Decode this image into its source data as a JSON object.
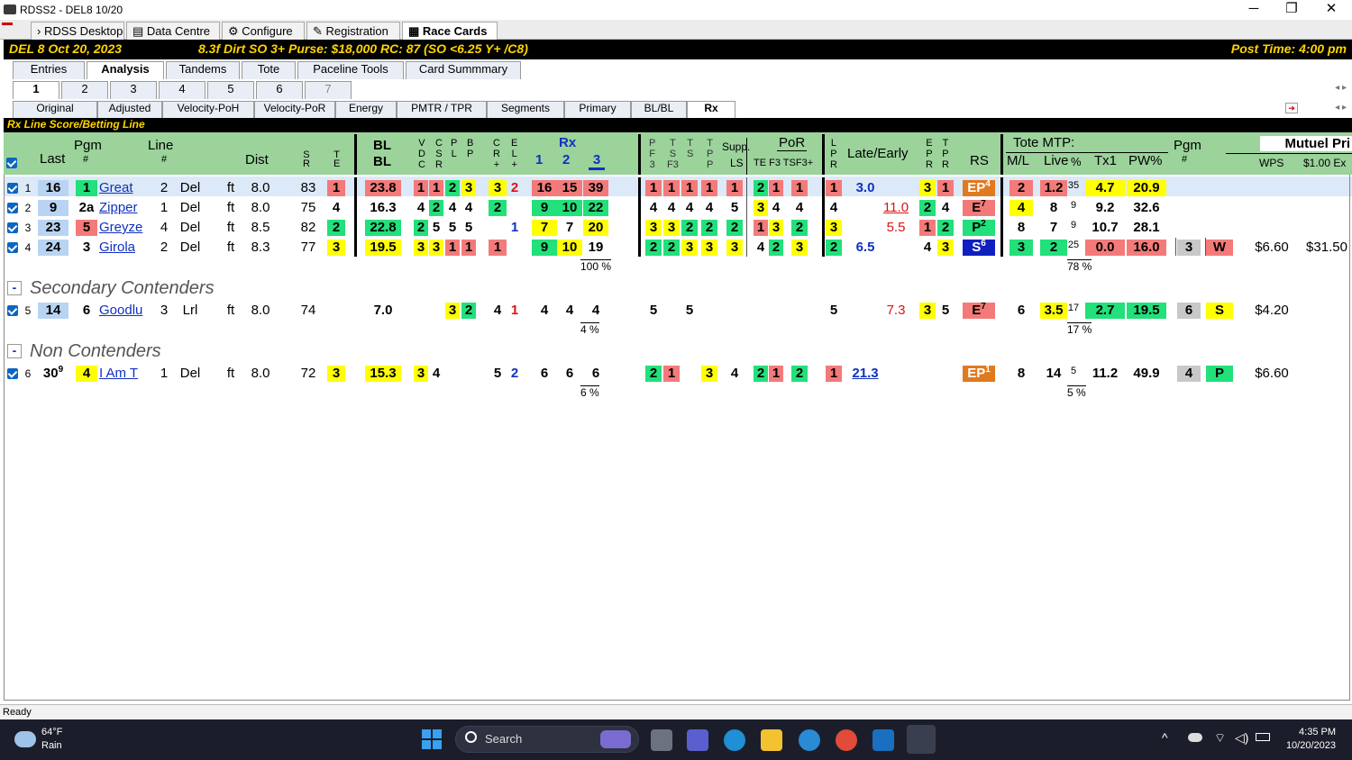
{
  "window": {
    "title": "RDSS2 - DEL8  10/20",
    "minimize": "─",
    "maximize": "❐",
    "close": "✕"
  },
  "top_tabs": [
    "RDSS Desktop",
    "Data Centre",
    "Configure",
    "Registration",
    "Race Cards"
  ],
  "race_bar": {
    "track": "DEL  8  Oct 20, 2023",
    "conditions": "8.3f  Dirt   SO  3+   Purse: $18,000   RC: 87  (SO <6.25 Y+ /C8)",
    "post_time": "Post Time: 4:00 pm"
  },
  "view_tabs": [
    "Entries",
    "Analysis",
    "Tandems",
    "Tote",
    "Paceline Tools",
    "Card Summmary"
  ],
  "race_tabs": [
    "1",
    "2",
    "3",
    "4",
    "5",
    "6",
    "7"
  ],
  "analysis_tabs": [
    "Original",
    "Adjusted",
    "Velocity-PoH",
    "Velocity-PoR",
    "Energy",
    "PMTR / TPR",
    "Segments",
    "Primary",
    "BL/BL",
    "Rx"
  ],
  "rx_title": "Rx Line Score/Betting Line",
  "header": {
    "last": "Last",
    "pgm": "Pgm",
    "pgm_hash": "#",
    "line": "Line",
    "line_hash": "#",
    "dist": "Dist",
    "sr_s": "S",
    "sr_r": "R",
    "te_t": "T",
    "te_e": "E",
    "bl1": "BL",
    "bl2": "BL",
    "vdc": [
      "V",
      "D",
      "C"
    ],
    "csr": [
      "C",
      "S",
      "R"
    ],
    "pl": [
      "P",
      "L"
    ],
    "bp": [
      "B",
      "P"
    ],
    "crp": [
      "C",
      "R",
      "+"
    ],
    "elp": [
      "E",
      "L",
      "+"
    ],
    "rx": "Rx",
    "rx1": "1",
    "rx2": "2",
    "rx3": "3",
    "pf3": [
      "P",
      "F",
      "3"
    ],
    "tsf3": [
      "T",
      "S",
      "F3"
    ],
    "ts": [
      "T",
      "S"
    ],
    "tpp": [
      "T",
      "P",
      "P"
    ],
    "supp": "Supp.",
    "ls": "LS",
    "por": "PoR",
    "por_sub": "TE F3  TSF3+",
    "lpr": [
      "L",
      "P",
      "R"
    ],
    "late_early": "Late/Early",
    "epr": [
      "E",
      "P",
      "R"
    ],
    "tpr": [
      "T",
      "P",
      "R"
    ],
    "rs": "RS",
    "tote_mtp": "Tote MTP:",
    "ml": "M/L",
    "live": "Live",
    "pct": "%",
    "tx1": "Tx1",
    "pw": "PW%",
    "pgm2": "Pgm",
    "pgm2_hash": "#",
    "mutuel": "Mutuel Pri",
    "wps": "WPS",
    "ex": "$1.00 Ex"
  },
  "rows": [
    {
      "n": "1",
      "last": "16",
      "pgm": "1",
      "name": "Great",
      "line": "2",
      "trk": "Del",
      "sfc": "ft",
      "dist": "8.0",
      "sr": "83",
      "te": "1",
      "bl": "23.8",
      "vdc": "1",
      "csr": "1",
      "pl": "2",
      "bp": "3",
      "cr": "3",
      "el": "2",
      "rx1": "16",
      "rx2": "15",
      "rx3": "39",
      "pf3": "1",
      "tsf": "1",
      "ts": "1",
      "tpp": "1",
      "ls": "1",
      "te2": "2",
      "f3": "1",
      "tsf3": "1",
      "lpr": "1",
      "late": "3.0",
      "early": "",
      "epr": "3",
      "tpr": "1",
      "rs": "EP",
      "rs_sup": "4",
      "ml": "2",
      "live": "1.2",
      "pctv": "35",
      "tx1": "4.7",
      "pw": "20.9",
      "pgm2": "",
      "wps": "",
      "price": "",
      "ex": ""
    },
    {
      "n": "2",
      "last": "9",
      "pgm": "2a",
      "name": "Zipper",
      "line": "1",
      "trk": "Del",
      "sfc": "ft",
      "dist": "8.0",
      "sr": "75",
      "te": "4",
      "bl": "16.3",
      "vdc": "4",
      "csr": "2",
      "pl": "4",
      "bp": "4",
      "cr": "2",
      "el": "",
      "rx1": "9",
      "rx2": "10",
      "rx3": "22",
      "pf3": "4",
      "tsf": "4",
      "ts": "4",
      "tpp": "4",
      "ls": "5",
      "te2": "3",
      "f3": "4",
      "tsf3": "4",
      "lpr": "4",
      "late": "",
      "early": "11.0",
      "epr": "2",
      "tpr": "4",
      "rs": "E",
      "rs_sup": "7",
      "ml": "4",
      "live": "8",
      "pctv": "9",
      "tx1": "9.2",
      "pw": "32.6",
      "pgm2": "",
      "wps": "",
      "price": "",
      "ex": ""
    },
    {
      "n": "3",
      "last": "23",
      "pgm": "5",
      "name": "Greyze",
      "line": "4",
      "trk": "Del",
      "sfc": "ft",
      "dist": "8.5",
      "sr": "82",
      "te": "2",
      "bl": "22.8",
      "vdc": "2",
      "csr": "5",
      "pl": "5",
      "bp": "5",
      "cr": "",
      "el": "1",
      "rx1": "7",
      "rx2": "7",
      "rx3": "20",
      "pf3": "3",
      "tsf": "3",
      "ts": "2",
      "tpp": "2",
      "ls": "2",
      "te2": "1",
      "f3": "3",
      "tsf3": "2",
      "lpr": "3",
      "late": "",
      "early": "5.5",
      "epr": "1",
      "tpr": "2",
      "rs": "P",
      "rs_sup": "2",
      "ml": "8",
      "live": "7",
      "pctv": "9",
      "tx1": "10.7",
      "pw": "28.1",
      "pgm2": "",
      "wps": "",
      "price": "",
      "ex": ""
    },
    {
      "n": "4",
      "last": "24",
      "pgm": "3",
      "name": "Girola",
      "line": "2",
      "trk": "Del",
      "sfc": "ft",
      "dist": "8.3",
      "sr": "77",
      "te": "3",
      "bl": "19.5",
      "vdc": "3",
      "csr": "3",
      "pl": "1",
      "bp": "1",
      "cr": "1",
      "el": "",
      "rx1": "9",
      "rx2": "10",
      "rx3": "19",
      "pf3": "2",
      "tsf": "2",
      "ts": "3",
      "tpp": "3",
      "ls": "3",
      "te2": "4",
      "f3": "2",
      "tsf3": "3",
      "lpr": "2",
      "late": "6.5",
      "early": "",
      "epr": "4",
      "tpr": "3",
      "rs": "S",
      "rs_sup": "6",
      "ml": "3",
      "live": "2",
      "pctv": "25",
      "tx1": "0.0",
      "pw": "16.0",
      "pgm2": "3",
      "wps": "W",
      "price": "$6.60",
      "ex": "$31.50"
    },
    {
      "n": "5",
      "last": "14",
      "pgm": "6",
      "name": "Goodlu",
      "line": "3",
      "trk": "Lrl",
      "sfc": "ft",
      "dist": "8.0",
      "sr": "74",
      "te": "",
      "bl": "7.0",
      "vdc": "",
      "csr": "",
      "pl": "3",
      "bp": "2",
      "cr": "4",
      "el": "1",
      "rx1": "4",
      "rx2": "4",
      "rx3": "4",
      "pf3": "5",
      "tsf": "",
      "ts": "5",
      "tpp": "",
      "ls": "",
      "te2": "",
      "f3": "",
      "tsf3": "",
      "lpr": "5",
      "late": "",
      "early": "7.3",
      "epr": "3",
      "tpr": "5",
      "rs": "E",
      "rs_sup": "7",
      "ml": "6",
      "live": "3.5",
      "pctv": "17",
      "tx1": "2.7",
      "pw": "19.5",
      "pgm2": "6",
      "wps": "S",
      "price": "$4.20",
      "ex": ""
    },
    {
      "n": "6",
      "last": "30",
      "last_sup": "9",
      "pgm": "4",
      "name": "I Am T",
      "line": "1",
      "trk": "Del",
      "sfc": "ft",
      "dist": "8.0",
      "sr": "72",
      "te": "3",
      "bl": "15.3",
      "vdc": "3",
      "csr": "4",
      "pl": "",
      "bp": "",
      "cr": "5",
      "el": "2",
      "rx1": "6",
      "rx2": "6",
      "rx3": "6",
      "pf3": "2",
      "tsf": "1",
      "ts": "",
      "tpp": "3",
      "ls": "4",
      "te2": "2",
      "f3": "1",
      "tsf3": "2",
      "lpr": "1",
      "late": "21.3",
      "early": "",
      "epr": "",
      "tpr": "",
      "rs": "EP",
      "rs_sup": "1",
      "ml": "8",
      "live": "14",
      "pctv": "5",
      "tx1": "11.2",
      "pw": "49.9",
      "pgm2": "4",
      "wps": "P",
      "price": "$6.60",
      "ex": ""
    }
  ],
  "percents": {
    "top": "100 %",
    "top_tote": "78 %",
    "sec": "4 %",
    "sec_tote": "17 %",
    "non": "6 %",
    "non_tote": "5 %"
  },
  "sections": {
    "secondary": "Secondary Contenders",
    "non": "Non Contenders"
  },
  "status": "Ready",
  "taskbar": {
    "temp": "64°F",
    "weather": "Rain",
    "search": "Search",
    "time": "4:35 PM",
    "date": "10/20/2023"
  }
}
